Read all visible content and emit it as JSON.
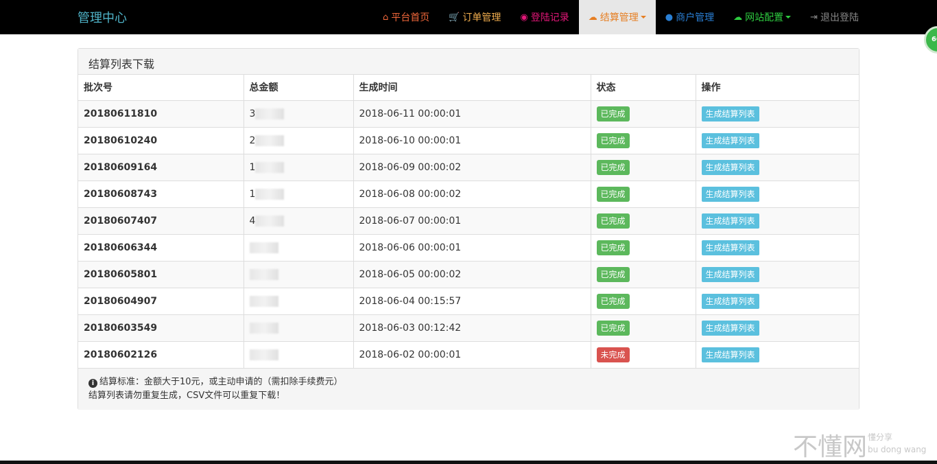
{
  "brand": "管理中心",
  "nav": [
    {
      "label": "平台首页",
      "icon": "home-icon",
      "glyph": "⌂",
      "color": "#f0673a"
    },
    {
      "label": "订单管理",
      "icon": "cart-icon",
      "glyph": "🛒",
      "color": "#f0ad4e"
    },
    {
      "label": "登陆记录",
      "icon": "camera-icon",
      "glyph": "◉",
      "color": "#e6177a"
    },
    {
      "label": "结算管理",
      "icon": "cloud-icon",
      "glyph": "☁",
      "color": "#e67e22"
    },
    {
      "label": "商户管理",
      "icon": "user-icon",
      "glyph": "●",
      "color": "#2a7fd4"
    },
    {
      "label": "网站配置",
      "icon": "cloud-icon",
      "glyph": "☁",
      "color": "#2ecc40"
    },
    {
      "label": "退出登陆",
      "icon": "logout-icon",
      "glyph": "⇥",
      "color": "#888888"
    }
  ],
  "bubble": "60",
  "panel": {
    "title": "结算列表下载",
    "headers": [
      "批次号",
      "总金额",
      "生成时间",
      "状态",
      "操作"
    ],
    "rows": [
      {
        "batch": "20180611810",
        "amount": "3",
        "time": "2018-06-11 00:00:01",
        "status": "已完成",
        "action": "生成结算列表"
      },
      {
        "batch": "20180610240",
        "amount": "2",
        "time": "2018-06-10 00:00:01",
        "status": "已完成",
        "action": "生成结算列表"
      },
      {
        "batch": "20180609164",
        "amount": "1",
        "time": "2018-06-09 00:00:02",
        "status": "已完成",
        "action": "生成结算列表"
      },
      {
        "batch": "20180608743",
        "amount": "1",
        "time": "2018-06-08 00:00:02",
        "status": "已完成",
        "action": "生成结算列表"
      },
      {
        "batch": "20180607407",
        "amount": "4",
        "time": "2018-06-07 00:00:01",
        "status": "已完成",
        "action": "生成结算列表"
      },
      {
        "batch": "20180606344",
        "amount": "",
        "time": "2018-06-06 00:00:01",
        "status": "已完成",
        "action": "生成结算列表"
      },
      {
        "batch": "20180605801",
        "amount": "",
        "time": "2018-06-05 00:00:02",
        "status": "已完成",
        "action": "生成结算列表"
      },
      {
        "batch": "20180604907",
        "amount": "",
        "time": "2018-06-04 00:15:57",
        "status": "已完成",
        "action": "生成结算列表"
      },
      {
        "batch": "20180603549",
        "amount": "",
        "time": "2018-06-03 00:12:42",
        "status": "已完成",
        "action": "生成结算列表"
      },
      {
        "batch": "20180602126",
        "amount": "",
        "time": "2018-06-02 00:00:01",
        "status": "未完成",
        "action": "生成结算列表"
      }
    ],
    "note_line1": "结算标准：金额大于10元，或主动申请的（需扣除手续费元）",
    "note_line2": "结算列表请勿重复生成，CSV文件可以重复下载！"
  },
  "watermark": {
    "main": "不懂网",
    "sub1": "懂分享",
    "sub2": "bu dong wang"
  },
  "colors": {
    "success": "#5cb85c",
    "danger": "#d9534f",
    "info": "#5bc0de"
  }
}
